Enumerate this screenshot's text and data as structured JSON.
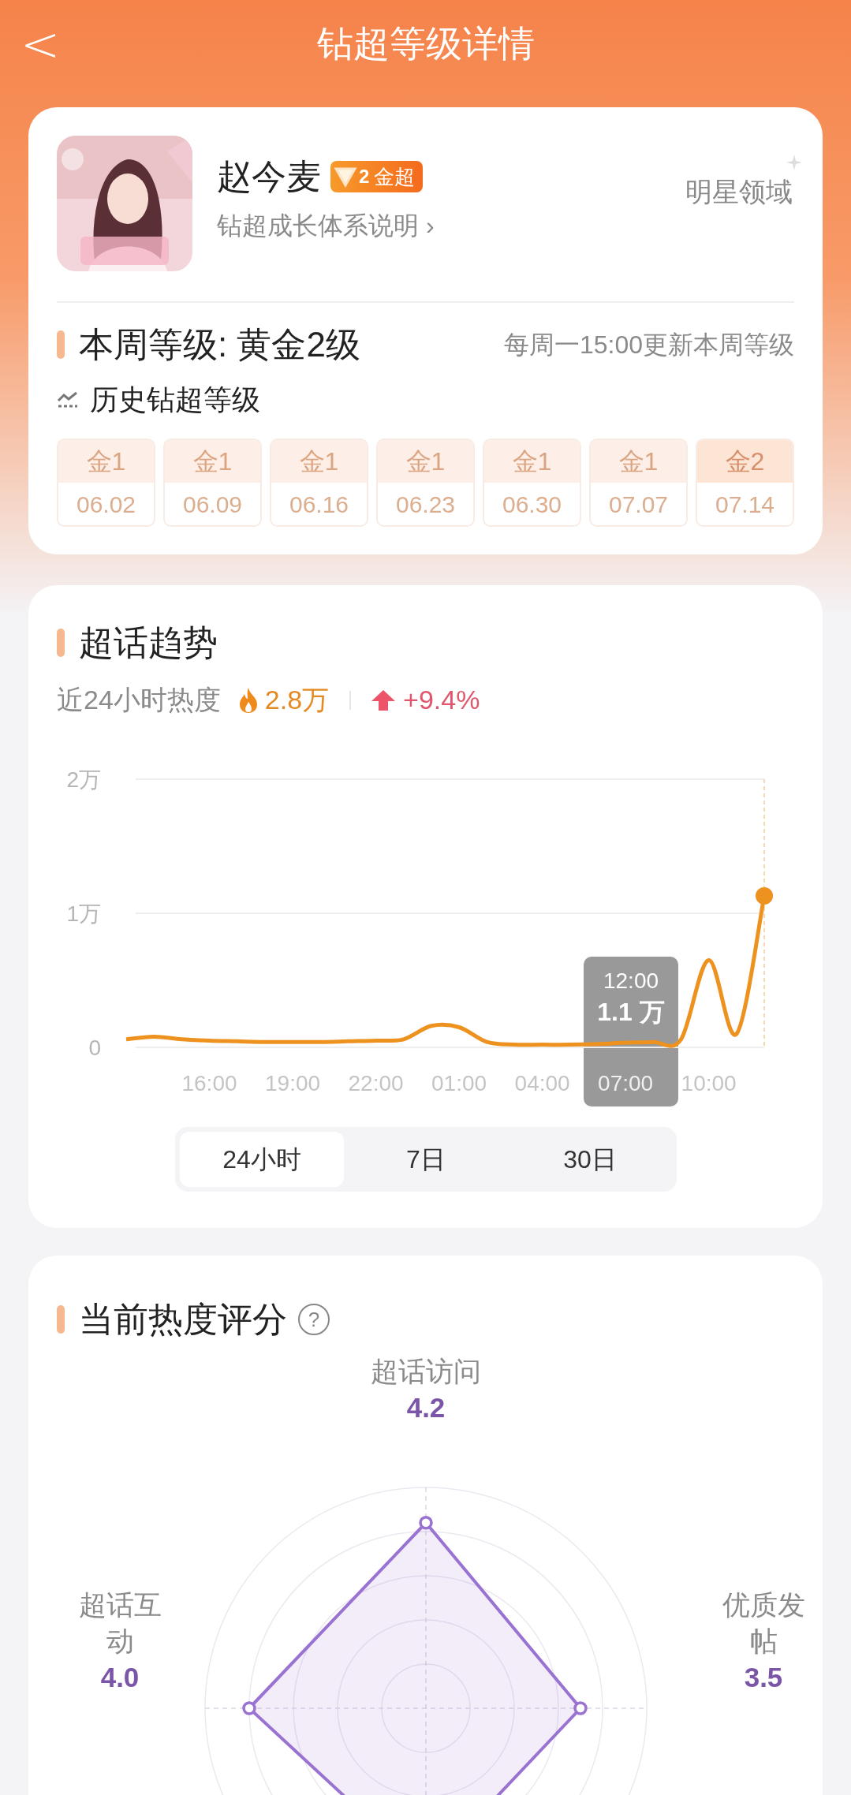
{
  "header": {
    "back": "<",
    "title": "钻超等级详情"
  },
  "profile": {
    "name": "赵今麦",
    "badge_digit": "2",
    "badge_text": "金超",
    "link": "钻超成长体系说明",
    "link_arrow": "›",
    "domain": "明星领域"
  },
  "level": {
    "title": "本周等级: 黄金2级",
    "note": "每周一15:00更新本周等级",
    "history_title": "历史钻超等级",
    "history": [
      {
        "level": "金1",
        "date": "06.02",
        "current": false
      },
      {
        "level": "金1",
        "date": "06.09",
        "current": false
      },
      {
        "level": "金1",
        "date": "06.16",
        "current": false
      },
      {
        "level": "金1",
        "date": "06.23",
        "current": false
      },
      {
        "level": "金1",
        "date": "06.30",
        "current": false
      },
      {
        "level": "金1",
        "date": "07.07",
        "current": false
      },
      {
        "level": "金2",
        "date": "07.14",
        "current": true
      }
    ]
  },
  "trend": {
    "title": "超话趋势",
    "heat_label": "近24小时热度",
    "heat_value": "2.8万",
    "change": "+9.4%",
    "chart_data": {
      "type": "line",
      "categories": [
        null,
        null,
        null,
        "16:00",
        null,
        null,
        "19:00",
        null,
        null,
        "22:00",
        null,
        null,
        "01:00",
        null,
        null,
        "04:00",
        null,
        null,
        "07:00",
        null,
        null,
        "10:00",
        null,
        null
      ],
      "yticks": [
        {
          "value": 0,
          "label": "0"
        },
        {
          "value": 1,
          "label": "1万"
        },
        {
          "value": 2,
          "label": "2万"
        }
      ],
      "ylim": [
        0,
        2
      ],
      "series": [
        {
          "color": "#ee921f",
          "values": [
            0.06,
            0.08,
            0.06,
            0.05,
            0.045,
            0.04,
            0.04,
            0.04,
            0.045,
            0.05,
            0.06,
            0.16,
            0.15,
            0.04,
            0.02,
            0.02,
            0.02,
            0.025,
            0.035,
            0.04,
            0.06,
            0.65,
            0.1,
            1.13
          ]
        }
      ]
    },
    "tooltip": {
      "time": "12:00",
      "value": "1.1 万"
    },
    "ranges": [
      {
        "label": "24小时",
        "selected": true
      },
      {
        "label": "7日",
        "selected": false
      },
      {
        "label": "30日",
        "selected": false
      }
    ]
  },
  "score": {
    "title": "当前热度评分",
    "help": "?",
    "axes": [
      {
        "label": "超话访问",
        "score": "4.2"
      },
      {
        "label": "超话互动",
        "score": "4.0"
      },
      {
        "label": "优质发帖",
        "score": "3.5"
      }
    ]
  }
}
